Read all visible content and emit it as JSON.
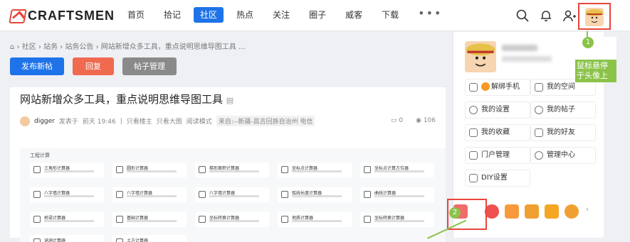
{
  "brand": {
    "logo_text": "CRAFTSMEN",
    "accent": "#1e73e8",
    "red": "#e8453c",
    "green": "#8bc34a"
  },
  "nav": {
    "items": [
      "首页",
      "拾记",
      "社区",
      "热点",
      "关注",
      "圈子",
      "威客",
      "下载"
    ],
    "active": "社区",
    "more": "•••"
  },
  "header_icons": [
    "search-icon",
    "bell-icon",
    "user-add-icon"
  ],
  "breadcrumb": [
    "社区",
    "站务",
    "站务公告",
    "网站新增众多工具，重点说明思维导图工具 ..."
  ],
  "buttons": {
    "publish": "发布新帖",
    "reply": "回复",
    "manage": "帖子管理"
  },
  "post": {
    "title": "网站新增众多工具，重点说明思维导图工具",
    "author": "digger",
    "posted_label": "发表于",
    "time": "前天 19:46",
    "links": [
      "只看楼主",
      "只看大图",
      "阅读模式"
    ],
    "location": "来自:--新疆-昌吉回族自治州 电信",
    "comments": "0",
    "views": "106"
  },
  "tools": {
    "header": "工程计算",
    "names": [
      "三角形计算器",
      "圆形计算器",
      "梯形面积计算器",
      "坐标点计算器",
      "坐标点计算方位器",
      "八字墙计算器",
      "八字墙计算器",
      "八字墙计算器",
      "弧线长度计算器",
      "曲线计算器",
      "桥梁计算器",
      "基础计算器",
      "坐标转换计算器",
      "地质计算器",
      "坐标转换计算器",
      "涵洞计算器",
      "土方计算器"
    ]
  },
  "panel": {
    "menu": [
      {
        "icon": "id-card-icon",
        "label": "解绑手机"
      },
      {
        "icon": "home-icon",
        "label": "我的空间"
      },
      {
        "icon": "settings-icon",
        "label": "我的设置"
      },
      {
        "icon": "chat-icon",
        "label": "我的帖子"
      },
      {
        "icon": "star-icon",
        "label": "我的收藏"
      },
      {
        "icon": "friends-icon",
        "label": "我的好友"
      },
      {
        "icon": "edit-icon",
        "label": "门户管理"
      },
      {
        "icon": "gear-icon",
        "label": "管理中心"
      },
      {
        "icon": "diy-icon",
        "label": "DIY设置"
      }
    ]
  },
  "annotations": {
    "step1": "1",
    "step1_text": "鼠标悬停于头像上",
    "step2": "2"
  }
}
